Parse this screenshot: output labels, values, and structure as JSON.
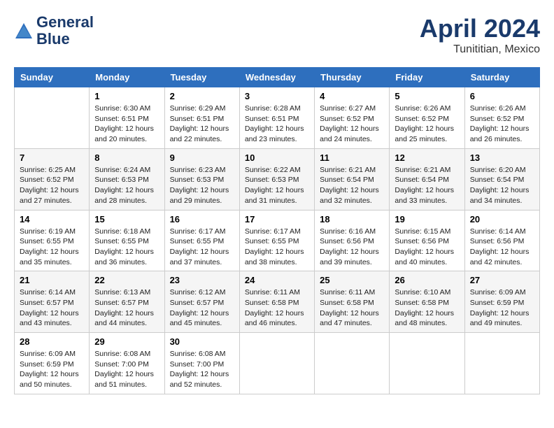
{
  "header": {
    "logo_line1": "General",
    "logo_line2": "Blue",
    "month": "April 2024",
    "location": "Tunititian, Mexico"
  },
  "weekdays": [
    "Sunday",
    "Monday",
    "Tuesday",
    "Wednesday",
    "Thursday",
    "Friday",
    "Saturday"
  ],
  "weeks": [
    [
      {
        "day": "",
        "sunrise": "",
        "sunset": "",
        "daylight": ""
      },
      {
        "day": "1",
        "sunrise": "Sunrise: 6:30 AM",
        "sunset": "Sunset: 6:51 PM",
        "daylight": "Daylight: 12 hours and 20 minutes."
      },
      {
        "day": "2",
        "sunrise": "Sunrise: 6:29 AM",
        "sunset": "Sunset: 6:51 PM",
        "daylight": "Daylight: 12 hours and 22 minutes."
      },
      {
        "day": "3",
        "sunrise": "Sunrise: 6:28 AM",
        "sunset": "Sunset: 6:51 PM",
        "daylight": "Daylight: 12 hours and 23 minutes."
      },
      {
        "day": "4",
        "sunrise": "Sunrise: 6:27 AM",
        "sunset": "Sunset: 6:52 PM",
        "daylight": "Daylight: 12 hours and 24 minutes."
      },
      {
        "day": "5",
        "sunrise": "Sunrise: 6:26 AM",
        "sunset": "Sunset: 6:52 PM",
        "daylight": "Daylight: 12 hours and 25 minutes."
      },
      {
        "day": "6",
        "sunrise": "Sunrise: 6:26 AM",
        "sunset": "Sunset: 6:52 PM",
        "daylight": "Daylight: 12 hours and 26 minutes."
      }
    ],
    [
      {
        "day": "7",
        "sunrise": "Sunrise: 6:25 AM",
        "sunset": "Sunset: 6:52 PM",
        "daylight": "Daylight: 12 hours and 27 minutes."
      },
      {
        "day": "8",
        "sunrise": "Sunrise: 6:24 AM",
        "sunset": "Sunset: 6:53 PM",
        "daylight": "Daylight: 12 hours and 28 minutes."
      },
      {
        "day": "9",
        "sunrise": "Sunrise: 6:23 AM",
        "sunset": "Sunset: 6:53 PM",
        "daylight": "Daylight: 12 hours and 29 minutes."
      },
      {
        "day": "10",
        "sunrise": "Sunrise: 6:22 AM",
        "sunset": "Sunset: 6:53 PM",
        "daylight": "Daylight: 12 hours and 31 minutes."
      },
      {
        "day": "11",
        "sunrise": "Sunrise: 6:21 AM",
        "sunset": "Sunset: 6:54 PM",
        "daylight": "Daylight: 12 hours and 32 minutes."
      },
      {
        "day": "12",
        "sunrise": "Sunrise: 6:21 AM",
        "sunset": "Sunset: 6:54 PM",
        "daylight": "Daylight: 12 hours and 33 minutes."
      },
      {
        "day": "13",
        "sunrise": "Sunrise: 6:20 AM",
        "sunset": "Sunset: 6:54 PM",
        "daylight": "Daylight: 12 hours and 34 minutes."
      }
    ],
    [
      {
        "day": "14",
        "sunrise": "Sunrise: 6:19 AM",
        "sunset": "Sunset: 6:55 PM",
        "daylight": "Daylight: 12 hours and 35 minutes."
      },
      {
        "day": "15",
        "sunrise": "Sunrise: 6:18 AM",
        "sunset": "Sunset: 6:55 PM",
        "daylight": "Daylight: 12 hours and 36 minutes."
      },
      {
        "day": "16",
        "sunrise": "Sunrise: 6:17 AM",
        "sunset": "Sunset: 6:55 PM",
        "daylight": "Daylight: 12 hours and 37 minutes."
      },
      {
        "day": "17",
        "sunrise": "Sunrise: 6:17 AM",
        "sunset": "Sunset: 6:55 PM",
        "daylight": "Daylight: 12 hours and 38 minutes."
      },
      {
        "day": "18",
        "sunrise": "Sunrise: 6:16 AM",
        "sunset": "Sunset: 6:56 PM",
        "daylight": "Daylight: 12 hours and 39 minutes."
      },
      {
        "day": "19",
        "sunrise": "Sunrise: 6:15 AM",
        "sunset": "Sunset: 6:56 PM",
        "daylight": "Daylight: 12 hours and 40 minutes."
      },
      {
        "day": "20",
        "sunrise": "Sunrise: 6:14 AM",
        "sunset": "Sunset: 6:56 PM",
        "daylight": "Daylight: 12 hours and 42 minutes."
      }
    ],
    [
      {
        "day": "21",
        "sunrise": "Sunrise: 6:14 AM",
        "sunset": "Sunset: 6:57 PM",
        "daylight": "Daylight: 12 hours and 43 minutes."
      },
      {
        "day": "22",
        "sunrise": "Sunrise: 6:13 AM",
        "sunset": "Sunset: 6:57 PM",
        "daylight": "Daylight: 12 hours and 44 minutes."
      },
      {
        "day": "23",
        "sunrise": "Sunrise: 6:12 AM",
        "sunset": "Sunset: 6:57 PM",
        "daylight": "Daylight: 12 hours and 45 minutes."
      },
      {
        "day": "24",
        "sunrise": "Sunrise: 6:11 AM",
        "sunset": "Sunset: 6:58 PM",
        "daylight": "Daylight: 12 hours and 46 minutes."
      },
      {
        "day": "25",
        "sunrise": "Sunrise: 6:11 AM",
        "sunset": "Sunset: 6:58 PM",
        "daylight": "Daylight: 12 hours and 47 minutes."
      },
      {
        "day": "26",
        "sunrise": "Sunrise: 6:10 AM",
        "sunset": "Sunset: 6:58 PM",
        "daylight": "Daylight: 12 hours and 48 minutes."
      },
      {
        "day": "27",
        "sunrise": "Sunrise: 6:09 AM",
        "sunset": "Sunset: 6:59 PM",
        "daylight": "Daylight: 12 hours and 49 minutes."
      }
    ],
    [
      {
        "day": "28",
        "sunrise": "Sunrise: 6:09 AM",
        "sunset": "Sunset: 6:59 PM",
        "daylight": "Daylight: 12 hours and 50 minutes."
      },
      {
        "day": "29",
        "sunrise": "Sunrise: 6:08 AM",
        "sunset": "Sunset: 7:00 PM",
        "daylight": "Daylight: 12 hours and 51 minutes."
      },
      {
        "day": "30",
        "sunrise": "Sunrise: 6:08 AM",
        "sunset": "Sunset: 7:00 PM",
        "daylight": "Daylight: 12 hours and 52 minutes."
      },
      {
        "day": "",
        "sunrise": "",
        "sunset": "",
        "daylight": ""
      },
      {
        "day": "",
        "sunrise": "",
        "sunset": "",
        "daylight": ""
      },
      {
        "day": "",
        "sunrise": "",
        "sunset": "",
        "daylight": ""
      },
      {
        "day": "",
        "sunrise": "",
        "sunset": "",
        "daylight": ""
      }
    ]
  ]
}
